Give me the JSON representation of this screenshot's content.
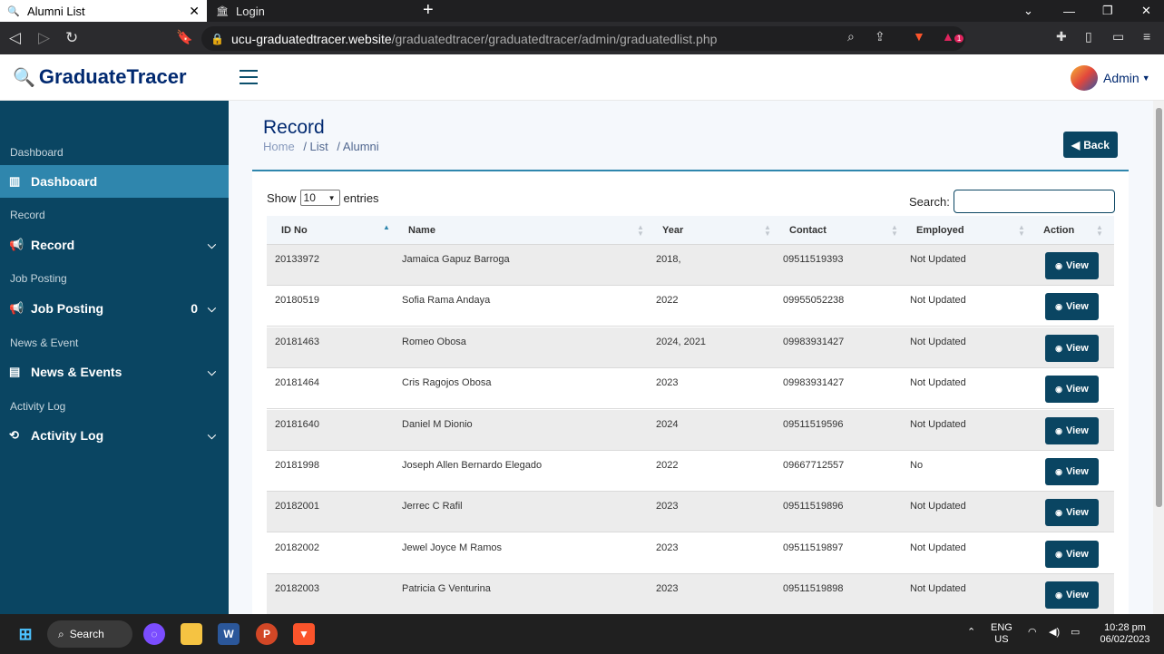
{
  "browser": {
    "active_tab": "Alumni List",
    "inactive_tab": "Login",
    "url_host": "ucu-graduatedtracer.website",
    "url_path": "/graduatedtracer/graduatedtracer/admin/graduatedlist.php",
    "ext_badge": "1"
  },
  "app": {
    "brand": "GraduateTracer",
    "user": "Admin"
  },
  "sidebar": {
    "groups": [
      {
        "heading": "Dashboard",
        "label": "Dashboard",
        "icon": "bar-chart-icon"
      },
      {
        "heading": "Record",
        "label": "Record",
        "icon": "megaphone-icon"
      },
      {
        "heading": "Job Posting",
        "label": "Job Posting",
        "icon": "megaphone-icon",
        "count": "0"
      },
      {
        "heading": "News & Event",
        "label": "News & Events",
        "icon": "newspaper-icon"
      },
      {
        "heading": "Activity Log",
        "label": "Activity Log",
        "icon": "history-icon"
      }
    ]
  },
  "page": {
    "title": "Record",
    "breadcrumbs": [
      "Home",
      "/ List",
      "/ Alumni"
    ],
    "back_label": "Back"
  },
  "table": {
    "show_label": "Show",
    "entries_value": "10",
    "entries_label": "entries",
    "search_label": "Search:",
    "columns": [
      "ID No",
      "Name",
      "Year",
      "Contact",
      "Employed",
      "Action"
    ],
    "rows": [
      {
        "id": "20133972",
        "name": "Jamaica Gapuz Barroga",
        "year": "2018,",
        "contact": "09511519393",
        "employed": "Not Updated"
      },
      {
        "id": "20180519",
        "name": "Sofia Rama Andaya",
        "year": "2022",
        "contact": "09955052238",
        "employed": "Not Updated"
      },
      {
        "id": "20181463",
        "name": "Romeo Obosa",
        "year": "2024, 2021",
        "contact": "09983931427",
        "employed": "Not Updated"
      },
      {
        "id": "20181464",
        "name": "Cris Ragojos Obosa",
        "year": "2023",
        "contact": "09983931427",
        "employed": "Not Updated"
      },
      {
        "id": "20181640",
        "name": "Daniel M Dionio",
        "year": "2024",
        "contact": "09511519596",
        "employed": "Not Updated"
      },
      {
        "id": "20181998",
        "name": "Joseph Allen Bernardo Elegado",
        "year": "2022",
        "contact": "09667712557",
        "employed": "No"
      },
      {
        "id": "20182001",
        "name": "Jerrec C Rafil",
        "year": "2023",
        "contact": "09511519896",
        "employed": "Not Updated"
      },
      {
        "id": "20182002",
        "name": "Jewel Joyce M Ramos",
        "year": "2023",
        "contact": "09511519897",
        "employed": "Not Updated"
      },
      {
        "id": "20182003",
        "name": "Patricia G Venturina",
        "year": "2023",
        "contact": "09511519898",
        "employed": "Not Updated"
      }
    ],
    "view_label": "View"
  },
  "taskbar": {
    "search_label": "Search",
    "lang_top": "ENG",
    "lang_bottom": "US",
    "time": "10:28 pm",
    "date": "06/02/2023"
  }
}
